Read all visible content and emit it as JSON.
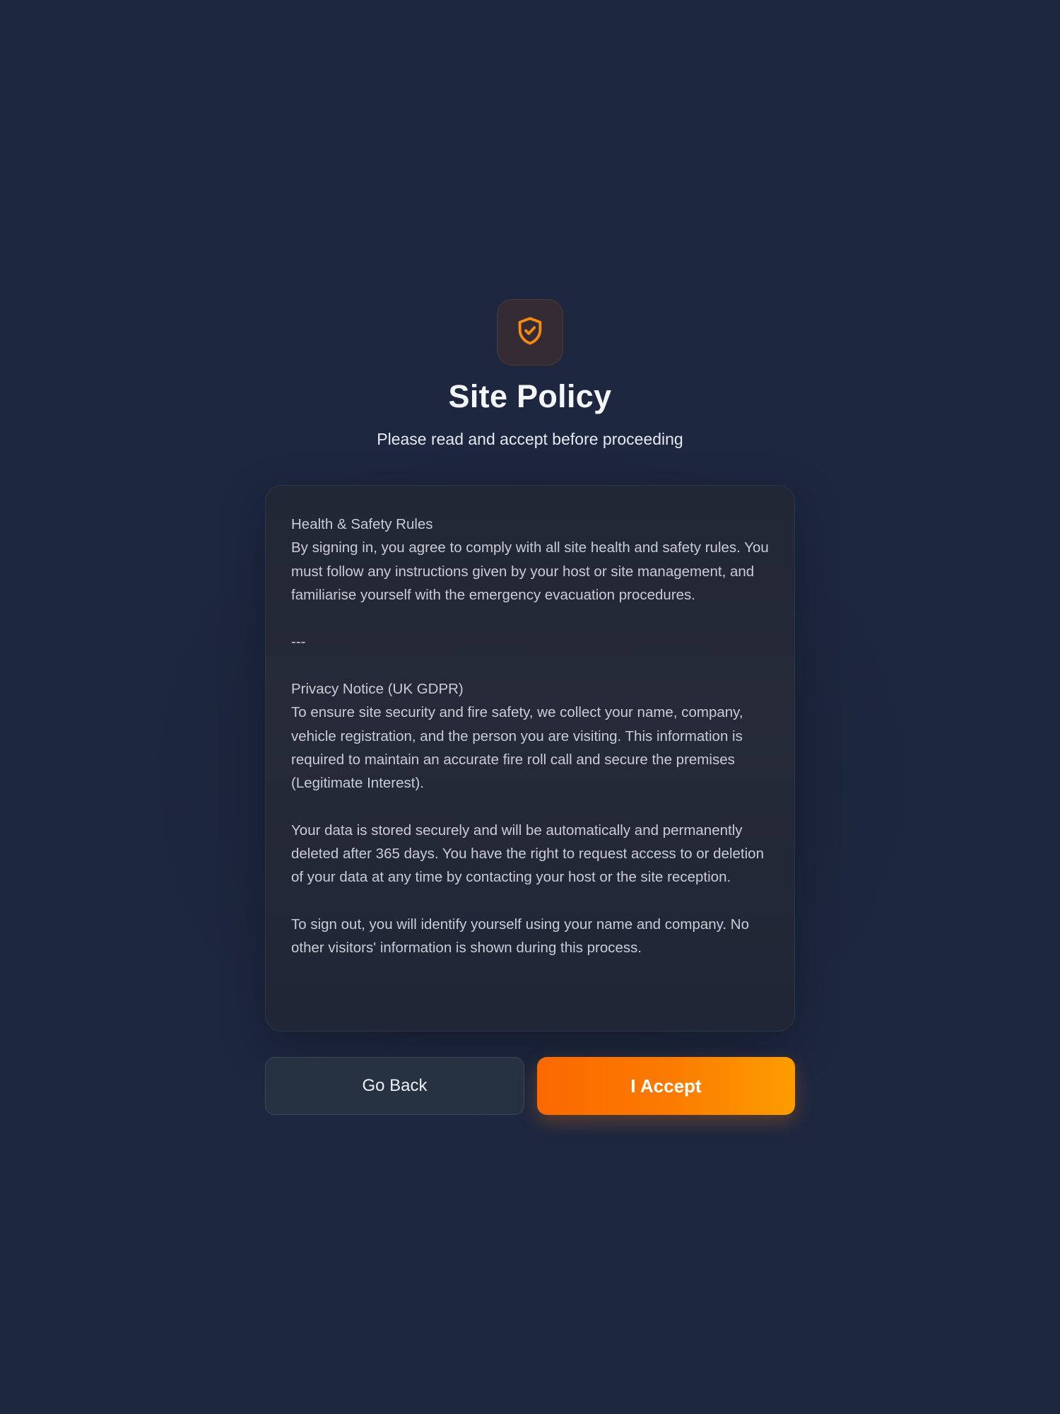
{
  "header": {
    "icon": "shield-check-icon",
    "title": "Site Policy",
    "subtitle": "Please read and accept before proceeding"
  },
  "policy": {
    "text": "Health & Safety Rules\nBy signing in, you agree to comply with all site health and safety rules. You must follow any instructions given by your host or site management, and familiarise yourself with the emergency evacuation procedures.\n\n---\n\nPrivacy Notice (UK GDPR)\nTo ensure site security and fire safety, we collect your name, company, vehicle registration, and the person you are visiting. This information is required to maintain an accurate fire roll call and secure the premises (Legitimate Interest).\n\nYour data is stored securely and will be automatically and permanently deleted after 365 days. You have the right to request access to or deletion of your data at any time by contacting your host or the site reception.\n\nTo sign out, you will identify yourself using your name and company. No other visitors' information is shown during this process."
  },
  "actions": {
    "back_label": "Go Back",
    "accept_label": "I Accept"
  },
  "colors": {
    "background": "#1d2740",
    "accent": "#fb7a00",
    "accent_end": "#fc9d00"
  }
}
